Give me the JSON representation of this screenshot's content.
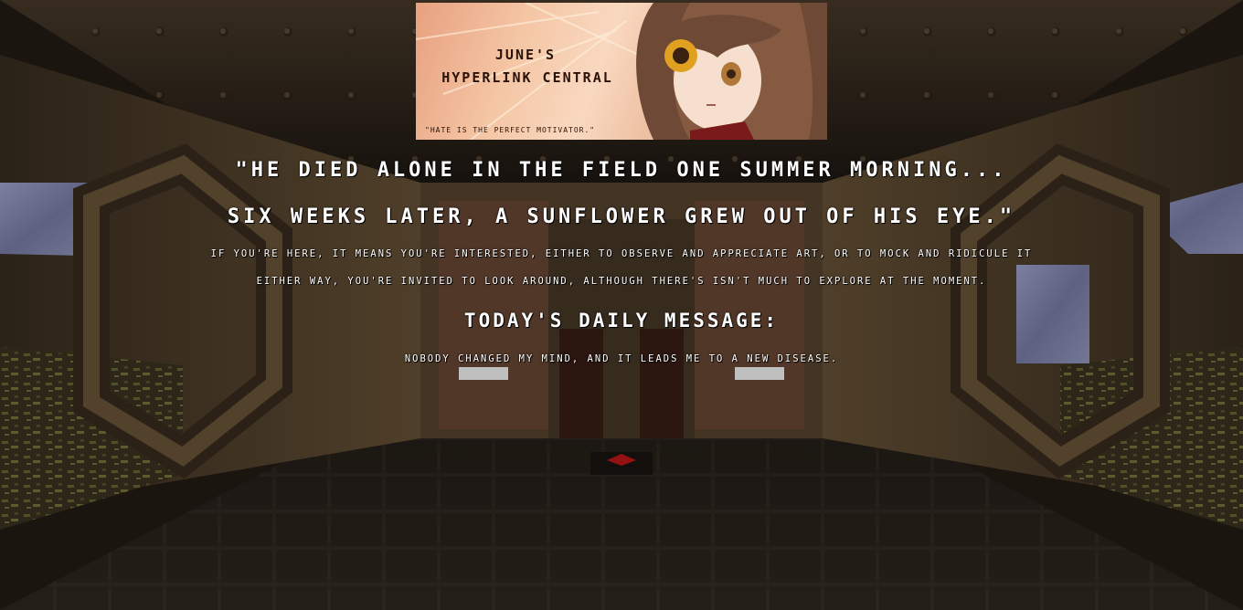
{
  "banner": {
    "title_line1": "June's",
    "title_line2": "Hyperlink Central",
    "quote": "\"Hate is the perfect motivator.\""
  },
  "quote": {
    "line1": "\"He died alone in the field one summer morning...",
    "line2": "Six weeks later, a sunflower grew out of his eye.\""
  },
  "intro": {
    "line1": "If you're here, it means you're interested, either to observe and appreciate art, or to mock and ridicule it",
    "line2": "Either way, you're invited to look around, although there's isn't much to explore at the moment."
  },
  "daily": {
    "heading": "Today's Daily Message:",
    "message": "Nobody changed my mind, and it leads me to a new disease."
  },
  "colors": {
    "text": "#ffffff",
    "metal": "#5a4630",
    "sky": "#8a8fb8"
  }
}
